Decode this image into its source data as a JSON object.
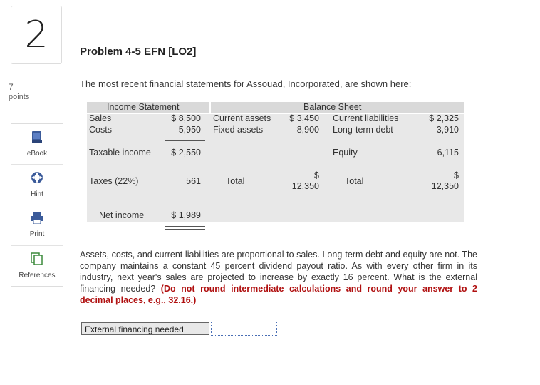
{
  "question": {
    "number": "2",
    "points_value": "7",
    "points_label": "points"
  },
  "tools": [
    {
      "label": "eBook"
    },
    {
      "label": "Hint"
    },
    {
      "label": "Print"
    },
    {
      "label": "References"
    }
  ],
  "problem": {
    "title": "Problem 4-5 EFN [LO2]",
    "intro": "The most recent financial statements for Assouad, Incorporated, are shown here:",
    "income_statement": {
      "header": "Income Statement",
      "sales_label": "Sales",
      "sales_value": "$ 8,500",
      "costs_label": "Costs",
      "costs_value": "5,950",
      "taxable_label": "Taxable income",
      "taxable_value": "$ 2,550",
      "taxes_label": "Taxes (22%)",
      "taxes_value": "561",
      "net_label": "Net income",
      "net_value": "$ 1,989"
    },
    "balance_sheet": {
      "header": "Balance Sheet",
      "ca_label": "Current assets",
      "ca_value": "$ 3,450",
      "fa_label": "Fixed assets",
      "fa_value": "8,900",
      "total_assets_label": "Total",
      "total_assets_dollar": "$",
      "total_assets_value": "12,350",
      "cl_label": "Current liabilities",
      "cl_value": "$ 2,325",
      "ltd_label": "Long-term debt",
      "ltd_value": "3,910",
      "equity_label": "Equity",
      "equity_value": "6,115",
      "total_le_label": "Total",
      "total_le_dollar": "$",
      "total_le_value": "12,350"
    },
    "paragraph": "Assets, costs, and current liabilities are proportional to sales. Long-term debt and equity are not. The company maintains a constant 45 percent dividend payout ratio. As with every other firm in its industry, next year's sales are projected to increase by exactly 16 percent. What is the external financing needed?",
    "instruction": "(Do not round intermediate calculations and round your answer to 2 decimal places, e.g., 32.16.)",
    "answer_label": "External financing needed",
    "answer_value": ""
  },
  "colors": {
    "instruction": "#b01010",
    "ebook_icon": "#3b5b9a",
    "hint_icon": "#3b5b9a",
    "print_icon": "#3b5b9a"
  },
  "icons": {
    "ebook": "book-icon",
    "hint": "lifebuoy-icon",
    "print": "printer-icon",
    "references": "documents-icon"
  }
}
